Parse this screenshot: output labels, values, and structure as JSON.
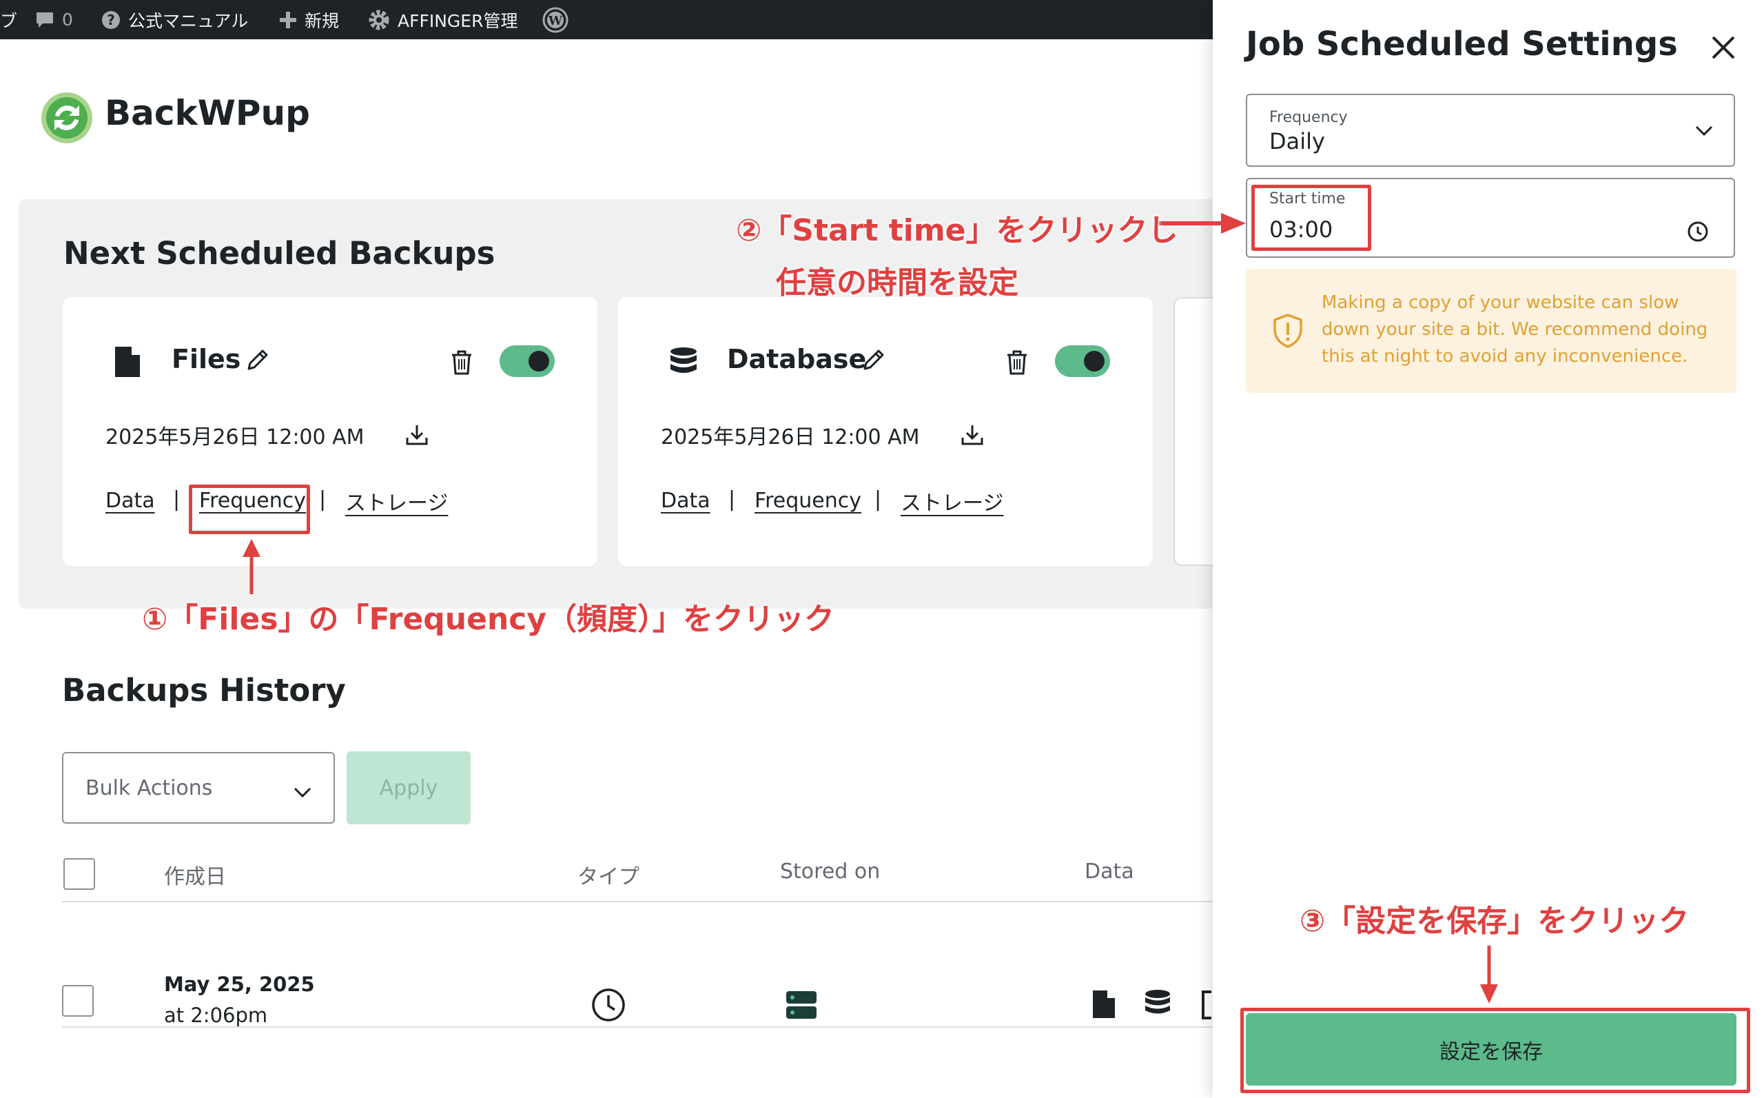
{
  "adminbar": {
    "left_glyph": "ブ",
    "comments_count": "0",
    "manual": "公式マニュアル",
    "new": "新規",
    "affinger": "AFFINGER管理"
  },
  "brand": {
    "name": "BackWPup"
  },
  "scheduled": {
    "title": "Next Scheduled Backups",
    "cards": [
      {
        "title": "Files",
        "date": "2025年5月26日 12:00 AM",
        "links": [
          "Data",
          "Frequency",
          "ストレージ"
        ],
        "enabled": true
      },
      {
        "title": "Database",
        "date": "2025年5月26日 12:00 AM",
        "links": [
          "Data",
          "Frequency",
          "ストレージ"
        ],
        "enabled": true
      }
    ]
  },
  "history": {
    "title": "Backups History",
    "bulk_actions": "Bulk Actions",
    "apply": "Apply",
    "columns": [
      "作成日",
      "タイプ",
      "Stored on",
      "Data"
    ],
    "rows": [
      {
        "date": "May 25, 2025",
        "time": "at 2:06pm"
      }
    ]
  },
  "panel": {
    "title": "Job Scheduled Settings",
    "frequency_label": "Frequency",
    "frequency_value": "Daily",
    "start_label": "Start time",
    "start_value": "03:00",
    "notice": "Making a copy of your website can slow down your site a bit. We recommend doing this at night to avoid any inconvenience.",
    "save": "設定を保存"
  },
  "annotations": {
    "step1": "①「Files」の「Frequency（頻度）」をクリック",
    "step2_line1": "②「Start time」をクリックし",
    "step2_line2": "任意の時間を設定",
    "step3": "③「設定を保存」をクリック"
  },
  "colors": {
    "accent_green": "#5dba8b",
    "annotation_red": "#e04040",
    "notice_bg": "#fdf2df",
    "notice_text": "#e0a133"
  }
}
